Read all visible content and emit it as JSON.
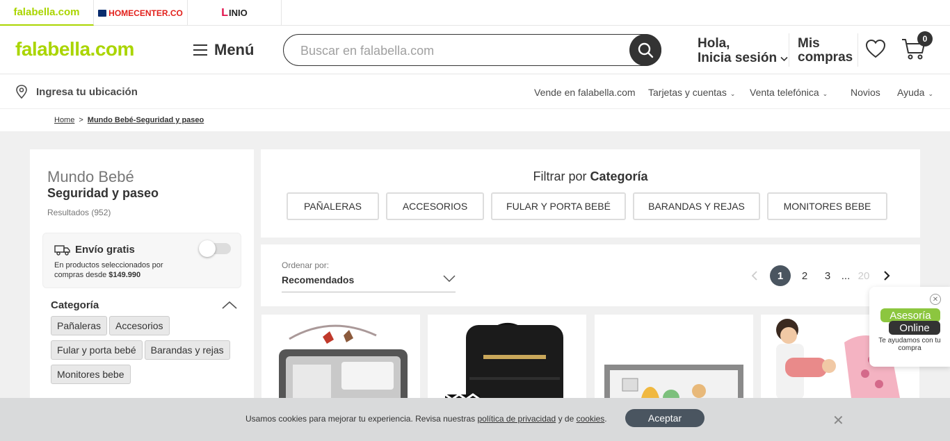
{
  "brands": {
    "falabella": "falabella.com",
    "homecenter": "HOMECENTER.CO",
    "linio": "INIO",
    "linio_mark": "L"
  },
  "header": {
    "logo": "falabella.com",
    "menu_label": "Menú",
    "search_placeholder": "Buscar en falabella.com",
    "greeting_line1": "Hola,",
    "greeting_line2": "Inicia sesión",
    "mis_compras_line1": "Mis",
    "mis_compras_line2": "compras",
    "cart_count": "0"
  },
  "subnav": {
    "location": "Ingresa tu ubicación",
    "links": [
      "Vende en falabella.com",
      "Tarjetas y cuentas",
      "Venta telefónica",
      "Novios",
      "Ayuda"
    ]
  },
  "breadcrumb": {
    "home": "Home",
    "separator": ">",
    "current": "Mundo Bebé-Seguridad y paseo"
  },
  "sidebar": {
    "title1": "Mundo Bebé",
    "title2": "Seguridad y paseo",
    "results": "Resultados (952)",
    "envio_title": "Envío gratis",
    "envio_desc": "En productos seleccionados por compras desde",
    "envio_amount": "$149.990",
    "envio_enabled": false,
    "category_heading": "Categoría",
    "categories": [
      "Pañaleras",
      "Accesorios",
      "Fular y porta bebé",
      "Barandas y rejas",
      "Monitores bebe"
    ]
  },
  "filter": {
    "title_prefix": "Filtrar por",
    "title_bold": "Categoría",
    "buttons": [
      "PAÑALERAS",
      "ACCESORIOS",
      "FULAR Y PORTA BEBÉ",
      "BARANDAS Y REJAS",
      "MONITORES BEBE"
    ]
  },
  "sort": {
    "label": "Ordenar por:",
    "value": "Recomendados"
  },
  "pagination": {
    "pages": [
      "1",
      "2",
      "3"
    ],
    "ellipsis": "...",
    "last": "20",
    "current": "1"
  },
  "products": [
    {
      "name": "playpen-image"
    },
    {
      "name": "backpack-image"
    },
    {
      "name": "bed-rail-image"
    },
    {
      "name": "baby-carrier-image"
    }
  ],
  "chat": {
    "bubble1": "Asesoría",
    "bubble2": "Online",
    "text": "Te ayudamos con tu compra"
  },
  "cookies": {
    "text_before": "Usamos cookies para mejorar tu experiencia. Revisa nuestras",
    "privacy_link": "política de privacidad",
    "text_middle": "y de",
    "cookies_link": "cookies",
    "text_end": ".",
    "accept": "Aceptar"
  },
  "colors": {
    "brand_green": "#aad500",
    "dark": "#333333",
    "pager_active": "#4a5560",
    "cookie_bg": "#d9dadb"
  }
}
